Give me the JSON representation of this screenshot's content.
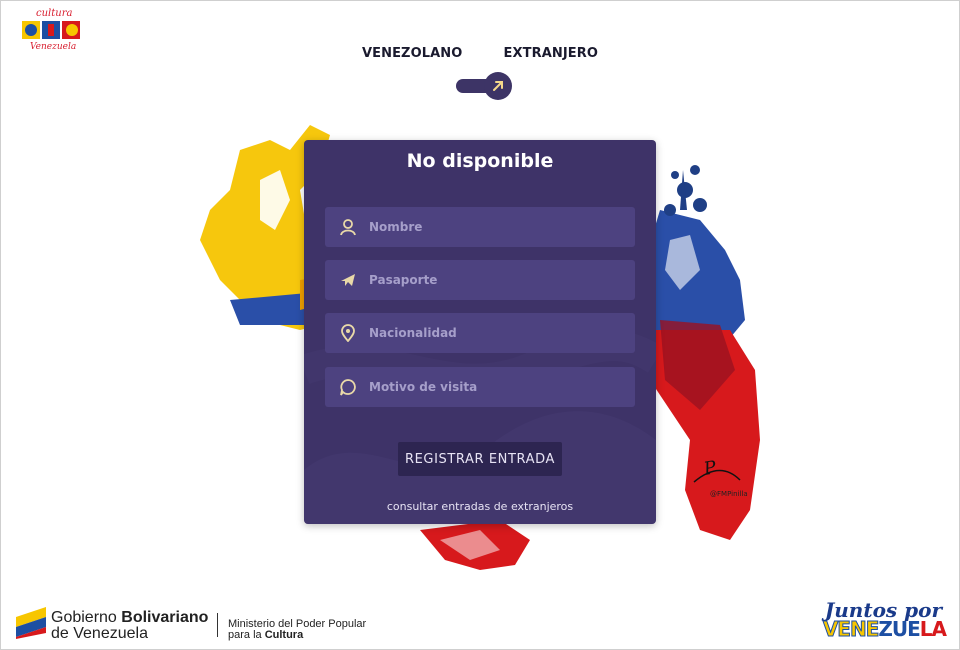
{
  "header": {
    "logo_top": "cultura",
    "logo_bottom": "Venezuela",
    "tabs": [
      "VENEZOLANO",
      "EXTRANJERO"
    ],
    "toggle_icon": "arrow-up-right-icon"
  },
  "card": {
    "title": "No disponible",
    "fields": [
      {
        "icon": "user-icon",
        "placeholder": "Nombre"
      },
      {
        "icon": "airplane-icon",
        "placeholder": "Pasaporte"
      },
      {
        "icon": "location-pin-icon",
        "placeholder": "Nacionalidad"
      },
      {
        "icon": "chat-bubble-icon",
        "placeholder": "Motivo de visita"
      }
    ],
    "submit_label": "REGISTRAR ENTRADA",
    "consult_link": "consultar entradas de extranjeros"
  },
  "art": {
    "signature": "Pinilla",
    "handle": "@FMPinilla"
  },
  "footer": {
    "gov_line1_prefix": "Gobierno ",
    "gov_line1_bold": "Bolivariano",
    "gov_line2": "de Venezuela",
    "ministry_line1": "Ministerio del Poder Popular",
    "ministry_line2_prefix": "para la ",
    "ministry_line2_bold": "Cultura",
    "slogan_top": "Juntos por",
    "slogan_bottom_1": "VENE",
    "slogan_bottom_2": "ZUE",
    "slogan_bottom_3": "LA"
  },
  "colors": {
    "card_bg": "#3e3368",
    "field_bg": "#4d4280",
    "button_bg": "#2d2551",
    "icon_accent": "#e9d9a8",
    "flag_yellow": "#f7c600",
    "flag_blue": "#1d4fa3",
    "flag_red": "#d7191c"
  }
}
